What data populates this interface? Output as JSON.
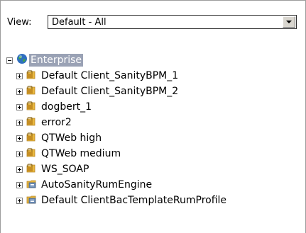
{
  "view": {
    "label": "View:",
    "selected": "Default - All"
  },
  "tree": {
    "root": {
      "label": "Enterprise",
      "icon": "globe-icon",
      "expanded": true
    },
    "children": [
      {
        "label": "Default Client_SanityBPM_1",
        "icon": "locked-folder-icon"
      },
      {
        "label": "Default Client_SanityBPM_2",
        "icon": "locked-folder-icon"
      },
      {
        "label": "dogbert_1",
        "icon": "locked-folder-icon"
      },
      {
        "label": "error2",
        "icon": "locked-folder-icon"
      },
      {
        "label": "QTWeb high",
        "icon": "locked-folder-icon"
      },
      {
        "label": "QTWeb medium",
        "icon": "locked-folder-icon"
      },
      {
        "label": "WS_SOAP",
        "icon": "locked-folder-icon"
      },
      {
        "label": "AutoSanityRumEngine",
        "icon": "rum-folder-icon"
      },
      {
        "label": "Default ClientBacTemplateRumProfile",
        "icon": "rum-folder-icon"
      }
    ]
  },
  "colors": {
    "selection": "#9aa2b5",
    "folder": "#e9b83f",
    "lock": "#8a6a1e"
  }
}
